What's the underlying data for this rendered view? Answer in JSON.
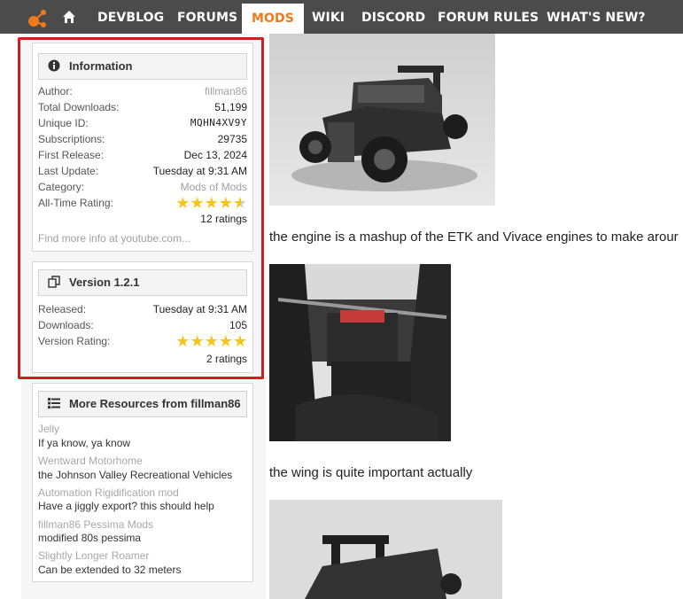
{
  "nav": {
    "items": [
      {
        "label": "DEVBLOG"
      },
      {
        "label": "FORUMS"
      },
      {
        "label": "MODS"
      },
      {
        "label": "WIKI"
      },
      {
        "label": "DISCORD"
      },
      {
        "label": "FORUM RULES"
      },
      {
        "label": "WHAT'S NEW?"
      }
    ],
    "active": "MODS",
    "accent": "#f07a17",
    "logo_icon": "beamng-logo-icon",
    "home_icon": "home-icon"
  },
  "info": {
    "title": "Information",
    "icon": "info-circle-icon",
    "rows": [
      {
        "k": "Author:",
        "v": "fillman86"
      },
      {
        "k": "Total Downloads:",
        "v": "51,199"
      },
      {
        "k": "Unique ID:",
        "v": "MQHN4XV9Y"
      },
      {
        "k": "Subscriptions:",
        "v": "29735"
      },
      {
        "k": "First Release:",
        "v": "Dec 13, 2024"
      },
      {
        "k": "Last Update:",
        "v": "Tuesday at 9:31 AM"
      },
      {
        "k": "Category:",
        "v": "Mods of Mods"
      },
      {
        "k": "All-Time Rating:",
        "v": ""
      }
    ],
    "rating_stars": 4.5,
    "ratings": "12 ratings",
    "find_more": "Find more info at youtube.com..."
  },
  "version": {
    "title": "Version 1.2.1",
    "icon": "copy-icon",
    "rows": [
      {
        "k": "Released:",
        "v": "Tuesday at 9:31 AM"
      },
      {
        "k": "Downloads:",
        "v": "105"
      },
      {
        "k": "Version Rating:",
        "v": ""
      }
    ],
    "rating_stars": 5,
    "ratings": "2 ratings"
  },
  "more": {
    "title": "More Resources from fillman86",
    "icon": "list-icon",
    "items": [
      {
        "title": "Jelly",
        "desc": "If ya know, ya know"
      },
      {
        "title": "Wentward Motorhome",
        "desc": "the Johnson Valley Recreational Vehicles"
      },
      {
        "title": "Automation Rigidification mod",
        "desc": "Have a jiggly export? this should help"
      },
      {
        "title": "fillman86 Pessima Mods",
        "desc": "modified 80s pessima"
      },
      {
        "title": "Slightly Longer Roamer",
        "desc": "Can be extended to 32 meters"
      }
    ]
  },
  "main": {
    "para1": "the engine is a mashup of the ETK and Vivace engines to make arour",
    "para2": "the wing is quite important actually"
  }
}
